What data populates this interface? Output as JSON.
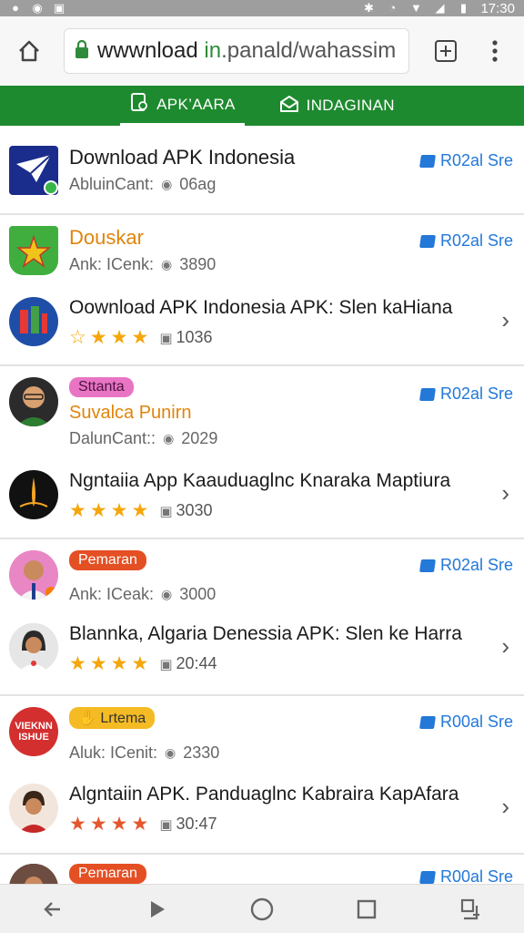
{
  "status_bar": {
    "time": "17:30",
    "left_icons": [
      "notification-icon",
      "camera-icon",
      "message-icon"
    ],
    "right_icons": [
      "bluetooth-icon",
      "alarm-icon",
      "wifi-icon",
      "signal-icon",
      "battery-icon"
    ]
  },
  "browser": {
    "url_parts": [
      "wwwnload ",
      "in",
      ".panald/wahassim"
    ],
    "home_icon": "home-icon",
    "lock_icon": "lock-icon",
    "tabs_icon": "new-tab-icon",
    "menu_icon": "more-vert-icon"
  },
  "tabs": [
    {
      "label": "APK’AARA",
      "icon": "apk-icon",
      "active": true
    },
    {
      "label": "INDAGINAN",
      "icon": "mail-icon",
      "active": false
    }
  ],
  "items": [
    {
      "title": "Download APK Indonesia",
      "meta_label": "AbluinCant:",
      "meta_value": "06ag",
      "verify": "R02al Sre"
    },
    {
      "title": "Douskar",
      "meta_label": "Ank: ICenk:",
      "meta_value": "3890",
      "verify": "R02al Sre"
    },
    {
      "title": "Oownload APK Indonesia APK: Slen kaHiana",
      "rating": 4,
      "meta_value": "1036"
    },
    {
      "badge": "Sttanta",
      "title": "Suvalca Punirn",
      "meta_label": "DalunCant::",
      "meta_value": "2029",
      "verify": "R02al Sre"
    },
    {
      "title": "Ngntaiia App Kaauduaglnc Knaraka Maptiura",
      "rating": 4,
      "meta_value": "3030"
    },
    {
      "badge": "Pemaran",
      "meta_label": "Ank: ICeak:",
      "meta_value": "3000",
      "verify": "R02al Sre"
    },
    {
      "title": "Blannka, Algaria Denessia APK: Slen ke Harra",
      "rating": 4,
      "meta_value": "20:44"
    },
    {
      "badge": "Lrtema",
      "avatar_text": "VIEKNN ISHUE",
      "meta_label": "Aluk: ICenit:",
      "meta_value": "2330",
      "verify": "R00al Sre"
    },
    {
      "title": "Algntaiin APK. Panduaglnc Kabraira KapAfara",
      "rating": 4,
      "meta_value": "30:47"
    },
    {
      "badge": "Pemaran",
      "verify": "R00al Sre"
    }
  ],
  "colors": {
    "brand_green": "#1e8a2f",
    "link_blue": "#2378d8",
    "star": "#f5a60a"
  },
  "nav": [
    "back-icon",
    "play-icon",
    "home-circle-icon",
    "recents-icon",
    "split-screen-icon"
  ]
}
